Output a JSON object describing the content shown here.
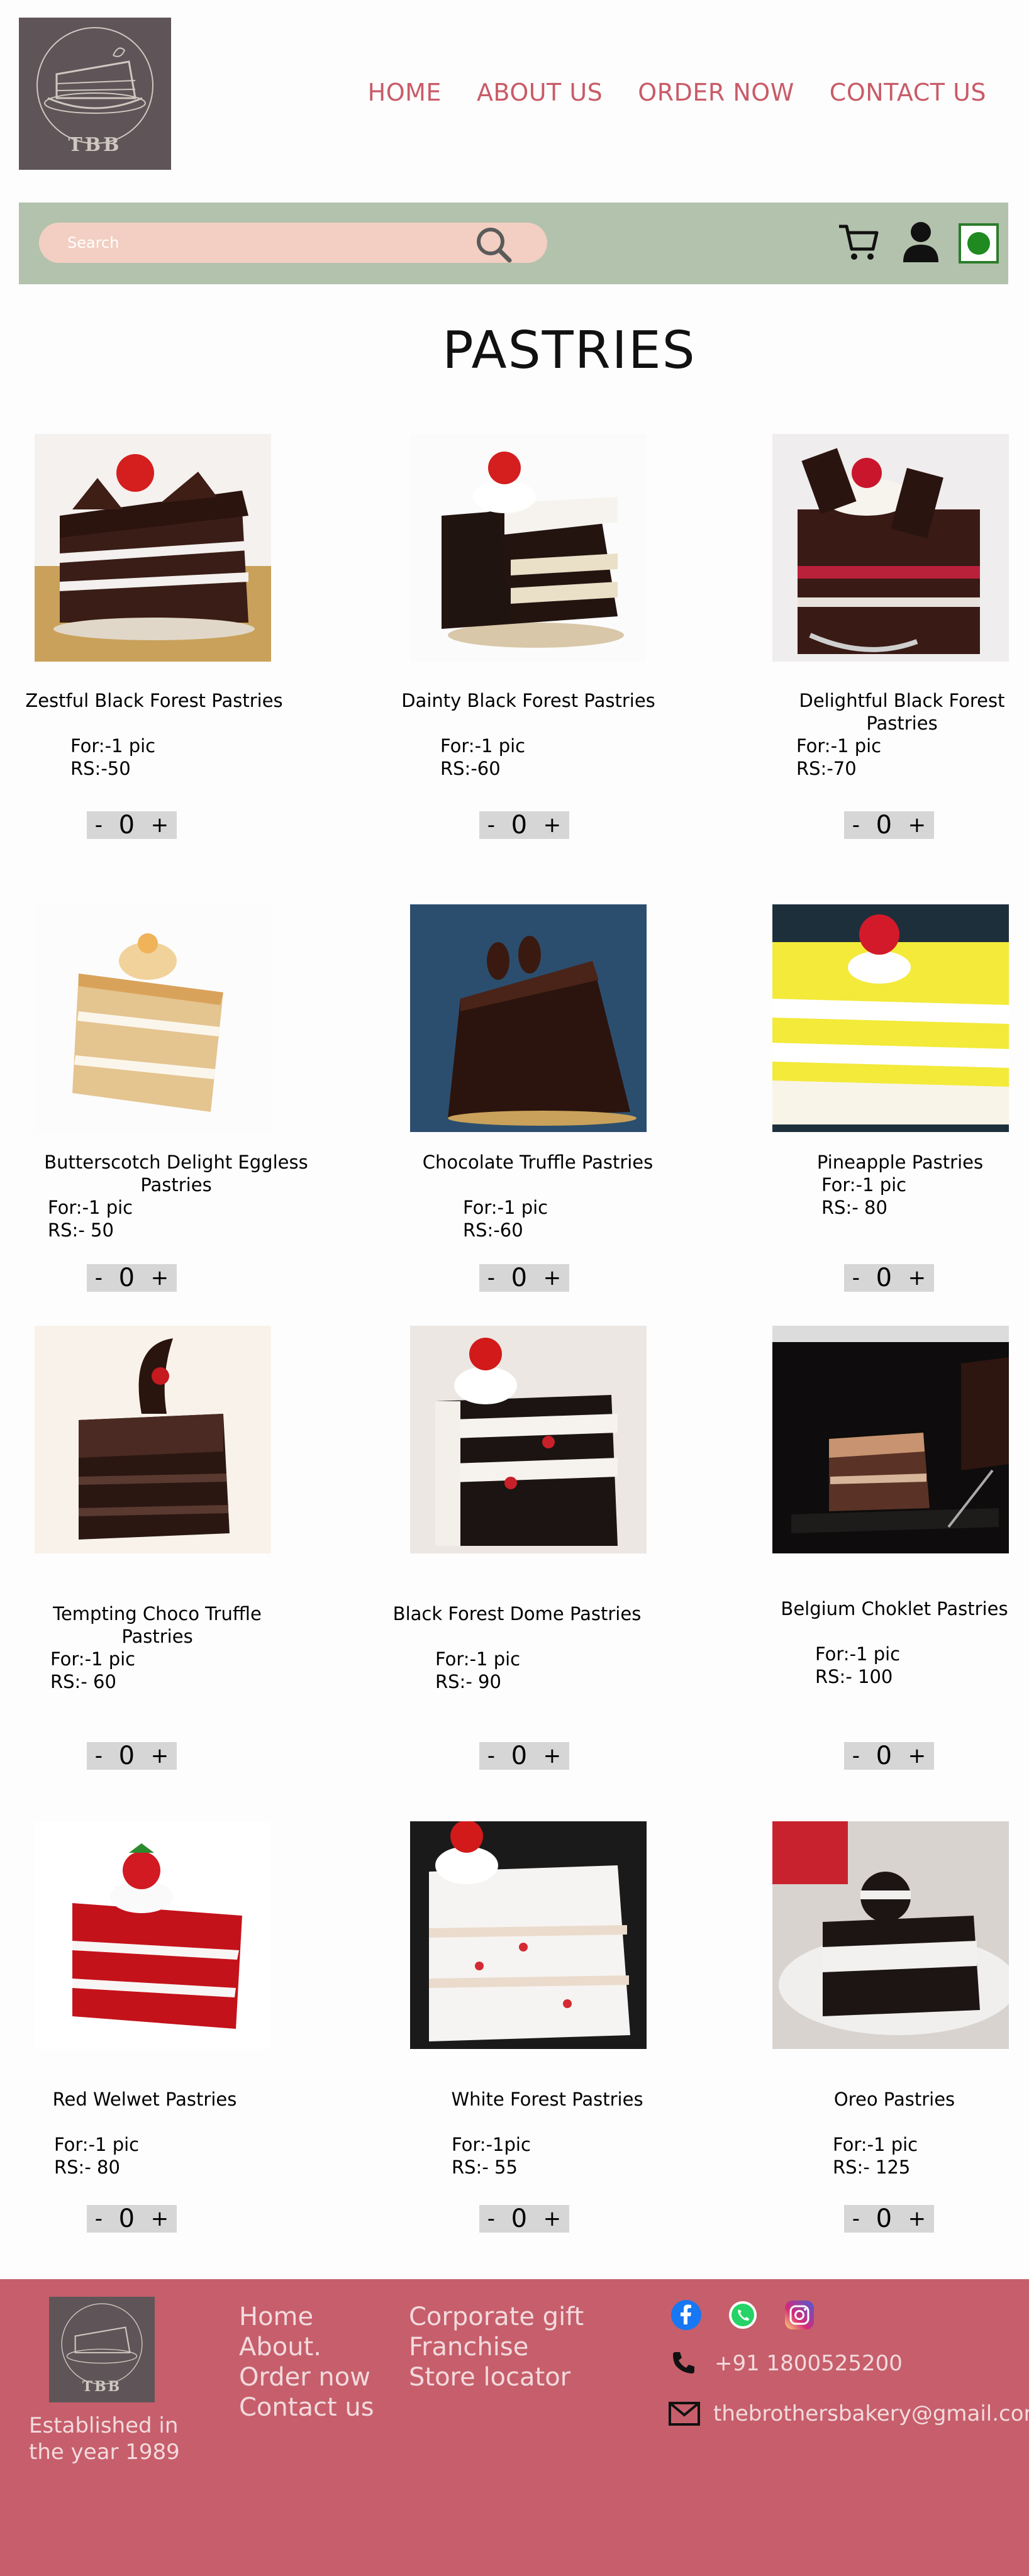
{
  "header": {
    "logo_text": "TBB",
    "nav": [
      "HOME",
      "ABOUT US",
      "ORDER NOW",
      "CONTACT US"
    ]
  },
  "search": {
    "placeholder": "Search"
  },
  "page_title": "PASTRIES",
  "products": [
    {
      "name": "Zestful Black Forest Pastries",
      "for": "For:-1 pic",
      "price": "RS:-50",
      "qty": "0"
    },
    {
      "name": "Dainty Black Forest Pastries",
      "for": "For:-1 pic",
      "price": "RS:-60",
      "qty": "0"
    },
    {
      "name": "Delightful Black Forest Pastries",
      "for": "For:-1 pic",
      "price": "RS:-70",
      "qty": "0"
    },
    {
      "name": "Butterscotch Delight Eggless Pastries",
      "for": "For:-1 pic",
      "price": "RS:- 50",
      "qty": "0"
    },
    {
      "name": "Chocolate Truffle Pastries",
      "for": "For:-1 pic",
      "price": "RS:-60",
      "qty": "0"
    },
    {
      "name": "Pineapple Pastries",
      "for": "For:-1 pic",
      "price": "RS:- 80",
      "qty": "0"
    },
    {
      "name": "Tempting Choco Truffle Pastries",
      "for": "For:-1 pic",
      "price": "RS:- 60",
      "qty": "0"
    },
    {
      "name": "Black Forest Dome Pastries",
      "for": "For:-1 pic",
      "price": "RS:- 90",
      "qty": "0"
    },
    {
      "name": "Belgium Choklet Pastries",
      "for": "For:-1 pic",
      "price": "RS:- 100",
      "qty": "0"
    },
    {
      "name": "Red Welwet Pastries",
      "for": "For:-1 pic",
      "price": "RS:- 80",
      "qty": "0"
    },
    {
      "name": "White Forest Pastries",
      "for": "For:-1pic",
      "price": "RS:- 55",
      "qty": "0"
    },
    {
      "name": "Oreo Pastries",
      "for": "For:-1 pic",
      "price": "RS:- 125",
      "qty": "0"
    }
  ],
  "qty_controls": {
    "minus": "-",
    "plus": "+"
  },
  "footer": {
    "logo_text": "TBB",
    "established": "Established in the year 1989",
    "links_col1": [
      "Home",
      "About.",
      "Order now",
      "Contact us"
    ],
    "links_col2": [
      "Corporate gift",
      "Franchise",
      "Store locator"
    ],
    "phone": "+91 1800525200",
    "email": "thebrothersbakery@gmail.com"
  },
  "colors": {
    "accent": "#c95b68",
    "searchbar_bg": "#b3c2ad",
    "search_input_bg": "#f2cfc2",
    "footer_bg": "#c65f6b",
    "qty_bg": "#d6d6d6"
  },
  "icons": [
    "search-icon",
    "cart-icon",
    "user-icon",
    "toggle-icon",
    "facebook-icon",
    "whatsapp-icon",
    "instagram-icon",
    "phone-icon",
    "mail-icon"
  ]
}
